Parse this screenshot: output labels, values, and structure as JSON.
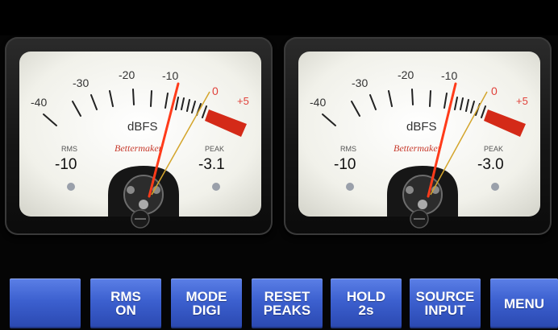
{
  "meters": [
    {
      "id": "left",
      "scale_labels": [
        "-40",
        "-30",
        "-20",
        "-10",
        "0",
        "+5"
      ],
      "unit": "dBFS",
      "brand": "Bettermaker",
      "rms_label": "RMS",
      "rms_value": "-10",
      "peak_label": "PEAK",
      "peak_value": "-3.1"
    },
    {
      "id": "right",
      "scale_labels": [
        "-40",
        "-30",
        "-20",
        "-10",
        "0",
        "+5"
      ],
      "unit": "dBFS",
      "brand": "Bettermaker",
      "rms_label": "RMS",
      "rms_value": "-10",
      "peak_label": "PEAK",
      "peak_value": "-3.0"
    }
  ],
  "buttons": [
    {
      "line1": "",
      "line2": ""
    },
    {
      "line1": "RMS",
      "line2": "ON"
    },
    {
      "line1": "MODE",
      "line2": "DIGI"
    },
    {
      "line1": "RESET",
      "line2": "PEAKS"
    },
    {
      "line1": "HOLD",
      "line2": "2s"
    },
    {
      "line1": "SOURCE",
      "line2": "INPUT"
    },
    {
      "line1": "MENU",
      "line2": ""
    }
  ],
  "colors": {
    "button_blue": "#3c60cf",
    "needle_red": "#ff3b1a",
    "peak_zone_red": "#d42a18",
    "face_white": "#f4f4ee",
    "scale_plus_red": "#e0413a"
  }
}
